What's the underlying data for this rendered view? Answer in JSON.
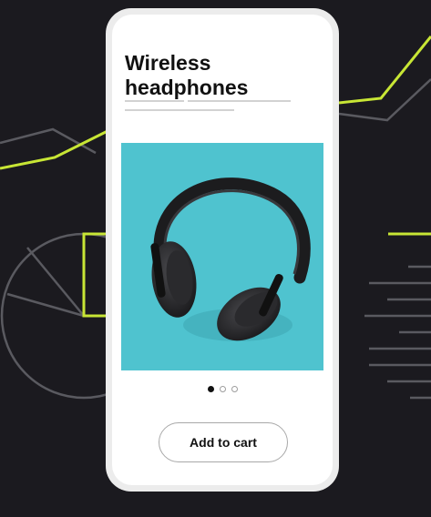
{
  "product": {
    "title_line1": "Wireless",
    "title_line2": "headphones"
  },
  "gallery": {
    "image_icon": "headphones-photo",
    "dots": 3,
    "active_dot": 1
  },
  "actions": {
    "add_to_cart_label": "Add to cart"
  },
  "colors": {
    "background": "#1b1a1f",
    "accent_lime": "#c8e635",
    "image_bg": "#4fc3cf"
  }
}
